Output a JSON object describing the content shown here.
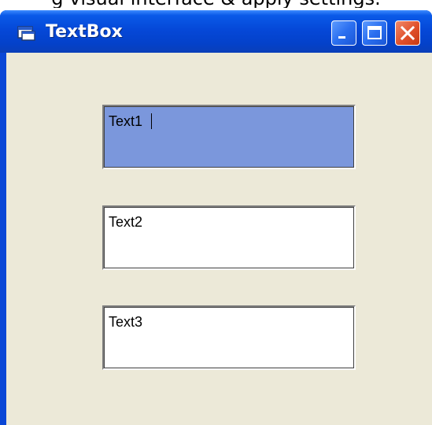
{
  "page_caption": "g visual interface & apply settings.",
  "window": {
    "title": "TextBox",
    "icon": "form-icon",
    "controls": {
      "minimize": "minimize-icon",
      "maximize": "maximize-icon",
      "close": "close-icon"
    }
  },
  "textboxes": [
    {
      "value": "Text1",
      "focused": true
    },
    {
      "value": "Text2",
      "focused": false
    },
    {
      "value": "Text3",
      "focused": false
    }
  ],
  "colors": {
    "titlebar": "#0548d8",
    "client_background": "#ece9d8",
    "selected_text_background": "#7b97dc",
    "close_button": "#e0502a"
  }
}
